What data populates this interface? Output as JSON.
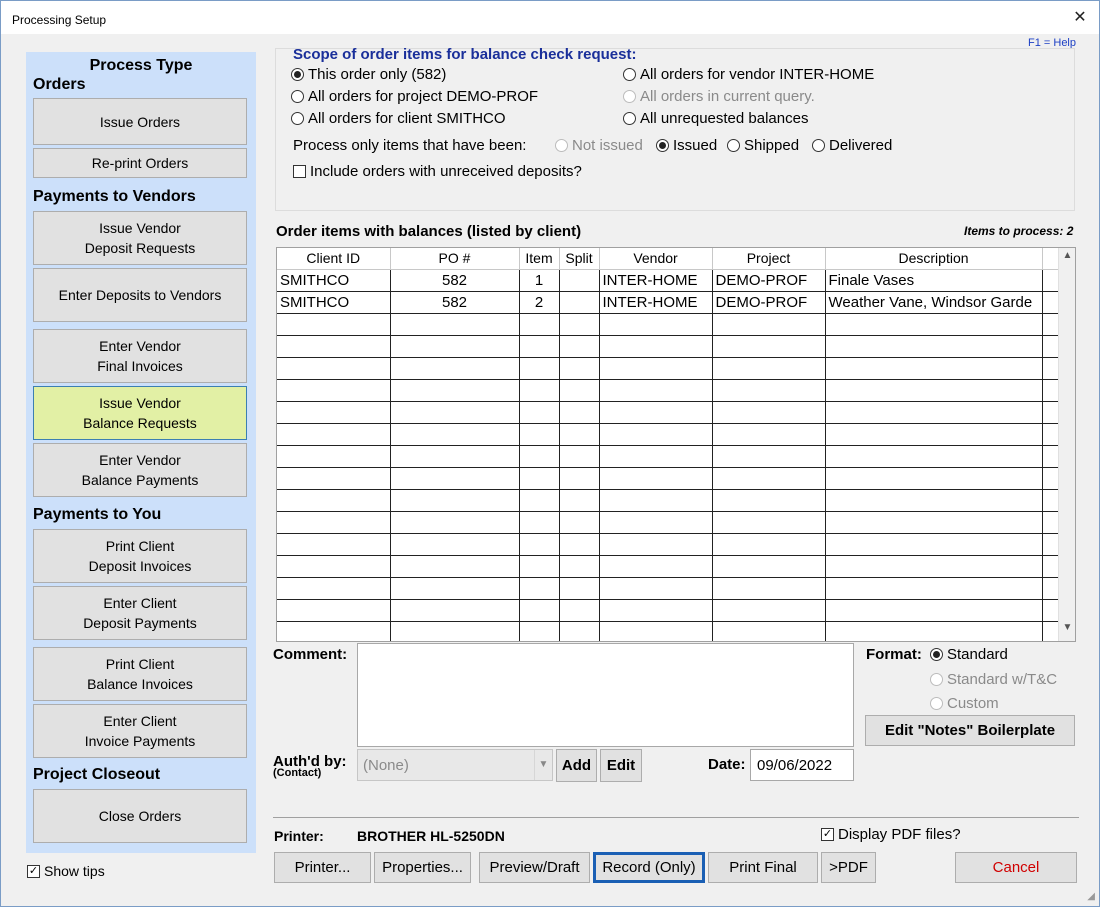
{
  "window": {
    "title": "Processing Setup",
    "close_icon": "close-icon",
    "help": "F1 = Help"
  },
  "left_panel": {
    "title": "Process Type",
    "sections": {
      "orders": "Orders",
      "payments_vendors": "Payments to Vendors",
      "payments_you": "Payments to You",
      "closeout": "Project Closeout"
    },
    "buttons": {
      "issue_orders": "Issue Orders",
      "reprint_orders": "Re-print Orders",
      "issue_vendor_deposit": "Issue Vendor\nDeposit Requests",
      "enter_deposits_vendors": "Enter Deposits to Vendors",
      "enter_vendor_final": "Enter Vendor\nFinal Invoices",
      "issue_vendor_balance": "Issue Vendor\nBalance Requests",
      "enter_vendor_balance_payments": "Enter Vendor\nBalance Payments",
      "print_client_deposit": "Print Client\nDeposit Invoices",
      "enter_client_deposit_payments": "Enter Client\nDeposit Payments",
      "print_client_balance": "Print Client\nBalance Invoices",
      "enter_client_invoice_payments": "Enter Client\nInvoice Payments",
      "close_orders": "Close Orders"
    },
    "active_button": "issue_vendor_balance"
  },
  "show_tips": {
    "label": "Show tips",
    "checked": true
  },
  "scope": {
    "title": "Scope of order items for balance check request:",
    "options": {
      "this_order": "This order only (582)",
      "project": "All orders for project DEMO-PROF",
      "client": "All orders for client SMITHCO",
      "vendor": "All orders for vendor INTER-HOME",
      "query": "All orders in current query.",
      "unrequested": "All unrequested balances"
    },
    "selected": "this_order",
    "process_label": "Process only items that have been:",
    "status_options": {
      "not_issued": "Not issued",
      "issued": "Issued",
      "shipped": "Shipped",
      "delivered": "Delivered"
    },
    "status_selected": "issued",
    "include_deposits": {
      "label": "Include orders with unreceived deposits?",
      "checked": false
    }
  },
  "items": {
    "heading": "Order items with balances (listed by client)",
    "count_label": "Items to process: 2",
    "columns": [
      "Client ID",
      "PO #",
      "Item",
      "Split",
      "Vendor",
      "Project",
      "Description"
    ],
    "rows": [
      [
        "SMITHCO",
        "582",
        "1",
        "",
        "INTER-HOME",
        "DEMO-PROF",
        "Finale Vases"
      ],
      [
        "SMITHCO",
        "582",
        "2",
        "",
        "INTER-HOME",
        "DEMO-PROF",
        "Weather Vane, Windsor Garde"
      ]
    ]
  },
  "comment": {
    "label": "Comment:",
    "value": ""
  },
  "format": {
    "label": "Format:",
    "options": {
      "standard": "Standard",
      "standard_tc": "Standard w/T&C",
      "custom": "Custom"
    },
    "selected": "standard",
    "boilerplate_button": "Edit \"Notes\" Boilerplate"
  },
  "auth": {
    "label": "Auth'd by:",
    "sub_label": "(Contact)",
    "value": "(None)",
    "add": "Add",
    "edit": "Edit"
  },
  "date": {
    "label": "Date:",
    "value": "09/06/2022"
  },
  "printer": {
    "label": "Printer:",
    "name": "BROTHER HL-5250DN",
    "display_pdf": {
      "label": "Display PDF files?",
      "checked": true
    }
  },
  "footer_buttons": {
    "printer": "Printer...",
    "properties": "Properties...",
    "preview": "Preview/Draft",
    "record": "Record (Only)",
    "print_final": "Print Final",
    "pdf": ">PDF",
    "cancel": "Cancel"
  },
  "colors": {
    "panel_bg": "#cce0fa",
    "active_button": "#e2f0a5",
    "scope_title": "#1a2f9a",
    "cancel_text": "#d00000"
  }
}
